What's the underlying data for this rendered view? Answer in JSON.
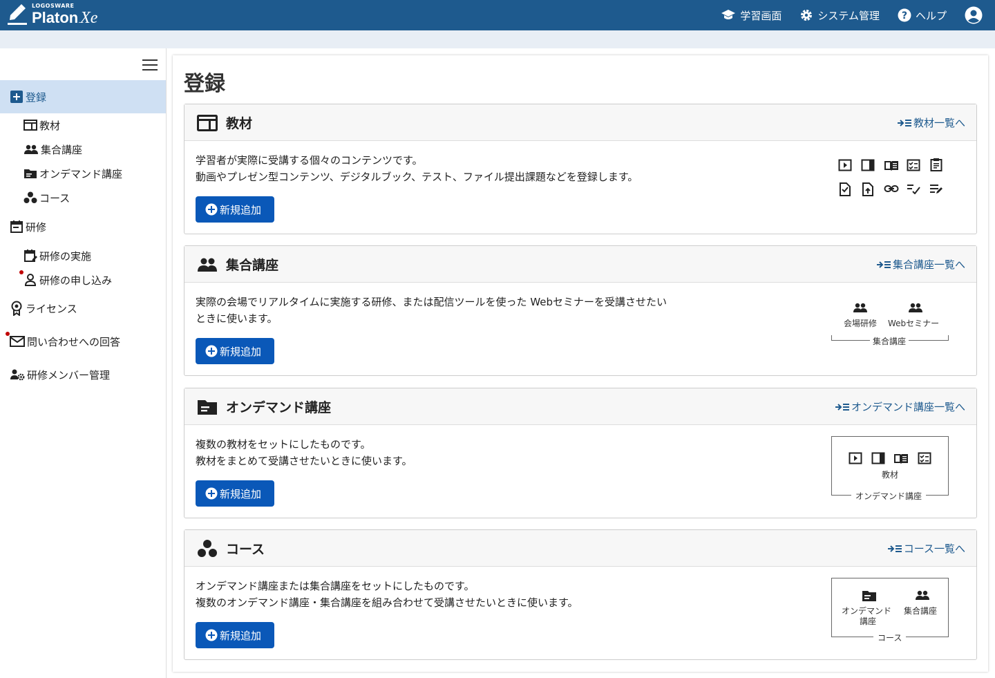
{
  "header": {
    "logo_small": "LOGOSWARE",
    "logo_main": "Platon",
    "logo_suffix": "Xe",
    "nav": [
      {
        "label": "学習画面",
        "icon": "graduation-cap-icon"
      },
      {
        "label": "システム管理",
        "icon": "gear-icon"
      },
      {
        "label": "ヘルプ",
        "icon": "help-icon"
      }
    ]
  },
  "sidebar": {
    "items": [
      {
        "label": "登録",
        "icon": "plus-box-icon"
      },
      {
        "label": "教材",
        "icon": "material-icon"
      },
      {
        "label": "集合講座",
        "icon": "group-icon"
      },
      {
        "label": "オンデマンド講座",
        "icon": "folder-icon"
      },
      {
        "label": "コース",
        "icon": "course-icon"
      },
      {
        "label": "研修",
        "icon": "calendar-icon"
      },
      {
        "label": "研修の実施",
        "icon": "calendar-edit-icon"
      },
      {
        "label": "研修の申し込み",
        "icon": "person-apply-icon"
      },
      {
        "label": "ライセンス",
        "icon": "license-icon"
      },
      {
        "label": "問い合わせへの回答",
        "icon": "mail-icon"
      },
      {
        "label": "研修メンバー管理",
        "icon": "member-settings-icon"
      }
    ]
  },
  "main": {
    "title": "登録",
    "cards": [
      {
        "title": "教材",
        "link": "教材一覧へ",
        "desc1": "学習者が実際に受講する個々のコンテンツです。",
        "desc2": "動画やプレゼン型コンテンツ、デジタルブック、テスト、ファイル提出課題などを登録します。",
        "button": "新規追加"
      },
      {
        "title": "集合講座",
        "link": "集合講座一覧へ",
        "desc1": "実際の会場でリアルタイムに実施する研修、または配信ツールを使った Webセミナーを受講させたい",
        "desc2": "ときに使います。",
        "button": "新規追加",
        "illus": {
          "item1": "会場研修",
          "item2": "Webセミナー",
          "group": "集合講座"
        }
      },
      {
        "title": "オンデマンド講座",
        "link": "オンデマンド講座一覧へ",
        "desc1": "複数の教材をセットにしたものです。",
        "desc2": "教材をまとめて受講させたいときに使います。",
        "button": "新規追加",
        "illus": {
          "item1": "教材",
          "group": "オンデマンド講座"
        }
      },
      {
        "title": "コース",
        "link": "コース一覧へ",
        "desc1": "オンデマンド講座または集合講座をセットにしたものです。",
        "desc2": "複数のオンデマンド講座・集合講座を組み合わせて受講させたいときに使います。",
        "button": "新規追加",
        "illus": {
          "item1a": "オンデマンド",
          "item1b": "講座",
          "item2": "集合講座",
          "group": "コース"
        }
      }
    ]
  }
}
